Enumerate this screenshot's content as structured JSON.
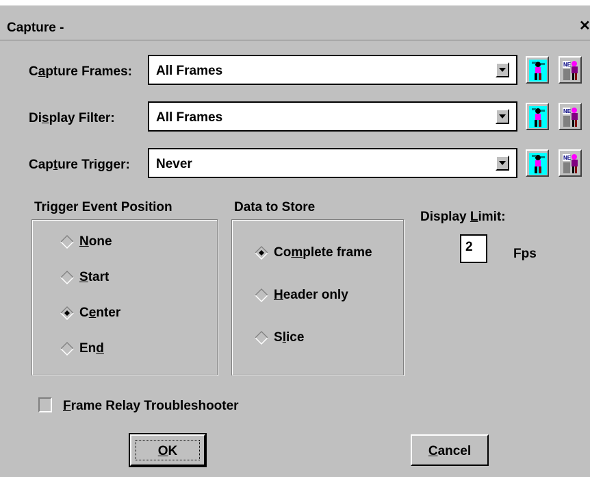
{
  "window": {
    "title": "Capture -",
    "close_glyph": "✕"
  },
  "rows": [
    {
      "label_pre": "C",
      "label_u": "a",
      "label_post": "pture Frames:",
      "value": "All Frames"
    },
    {
      "label_pre": "Di",
      "label_u": "s",
      "label_post": "play Filter:",
      "value": "All Frames"
    },
    {
      "label_pre": "Cap",
      "label_u": "t",
      "label_post": "ure Trigger:",
      "value": "Never"
    }
  ],
  "icons": {
    "left": "capture-person-icon",
    "right": "network-filter-icon"
  },
  "trigger_group": {
    "title": "Trigger Event Position",
    "options": [
      {
        "pre": "",
        "u": "N",
        "post": "one",
        "selected": false
      },
      {
        "pre": "",
        "u": "S",
        "post": "tart",
        "selected": false
      },
      {
        "pre": "C",
        "u": "e",
        "post": "nter",
        "selected": true
      },
      {
        "pre": "En",
        "u": "d",
        "post": "",
        "selected": false
      }
    ]
  },
  "store_group": {
    "title": "Data to Store",
    "options": [
      {
        "pre": "Co",
        "u": "m",
        "post": "plete frame",
        "selected": true
      },
      {
        "pre": "",
        "u": "H",
        "post": "eader only",
        "selected": false
      },
      {
        "pre": "S",
        "u": "l",
        "post": "ice",
        "selected": false
      }
    ]
  },
  "display_limit": {
    "label_pre": "Display ",
    "label_u": "L",
    "label_post": "imit:",
    "value": "2",
    "unit": "Fps"
  },
  "checkbox": {
    "pre": "",
    "u": "F",
    "post": "rame Relay Troubleshooter",
    "checked": false
  },
  "buttons": {
    "ok": {
      "pre": "",
      "u": "O",
      "post": "K"
    },
    "cancel": {
      "pre": "",
      "u": "C",
      "post": "ancel"
    }
  }
}
